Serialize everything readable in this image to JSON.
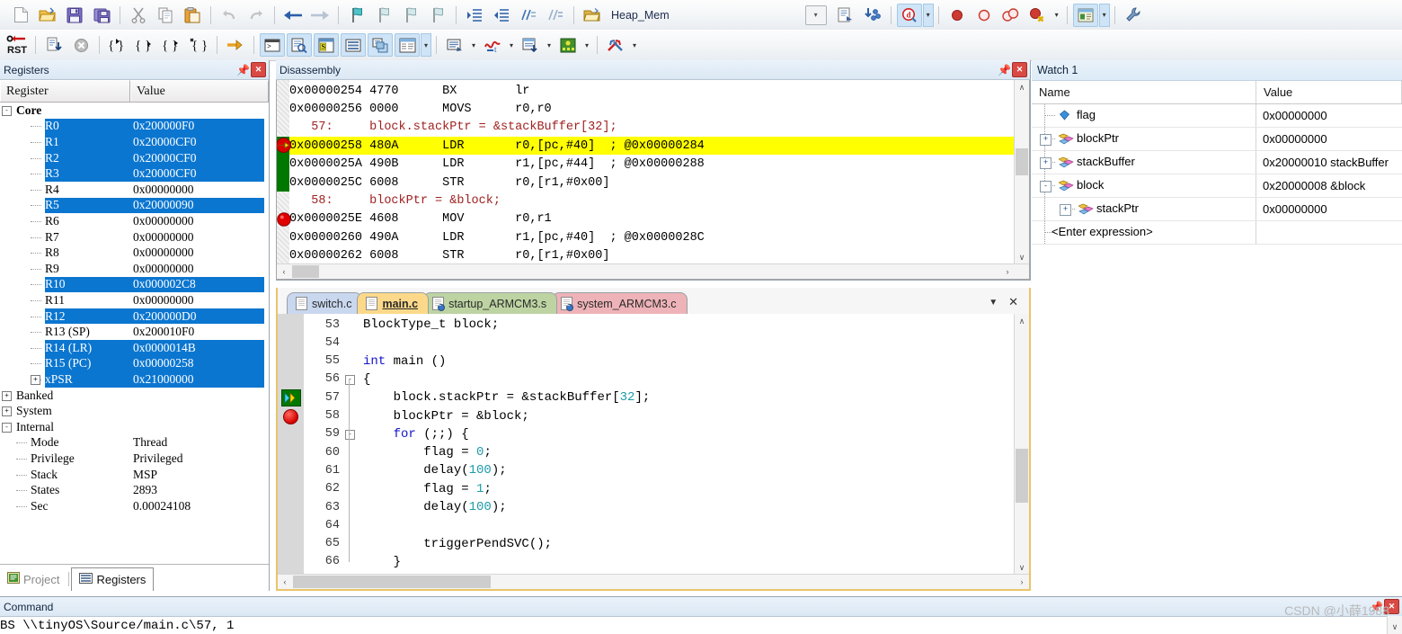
{
  "toolbar1": {
    "icons": [
      {
        "name": "new-file-icon",
        "glyph": "doc"
      },
      {
        "name": "open-file-icon",
        "glyph": "folder"
      },
      {
        "name": "save-icon",
        "glyph": "floppy"
      },
      {
        "name": "save-all-icon",
        "glyph": "floppy-multi"
      },
      {
        "name": "cut-icon",
        "glyph": "scissors"
      },
      {
        "name": "copy-icon",
        "glyph": "copy"
      },
      {
        "name": "paste-icon",
        "glyph": "paste"
      },
      {
        "name": "undo-icon",
        "glyph": "undo"
      },
      {
        "name": "redo-icon",
        "glyph": "redo"
      },
      {
        "name": "navigate-back-icon",
        "glyph": "arrow-left"
      },
      {
        "name": "navigate-forward-icon",
        "glyph": "arrow-right"
      },
      {
        "name": "bookmark-toggle-icon",
        "glyph": "flag"
      },
      {
        "name": "bookmark-prev-icon",
        "glyph": "flag-prev"
      },
      {
        "name": "bookmark-next-icon",
        "glyph": "flag-next"
      },
      {
        "name": "bookmark-clear-icon",
        "glyph": "flag-clear"
      },
      {
        "name": "indent-icon",
        "glyph": "indent"
      },
      {
        "name": "outdent-icon",
        "glyph": "outdent"
      },
      {
        "name": "comment-icon",
        "glyph": "comment"
      },
      {
        "name": "uncomment-icon",
        "glyph": "uncomment"
      }
    ],
    "combo_value": "Heap_Mem",
    "combo_icon": "open-project-icon",
    "after_combo": [
      {
        "name": "target-options-icon",
        "glyph": "target-opts"
      },
      {
        "name": "manage-components-icon",
        "glyph": "components"
      }
    ],
    "debug_tool": {
      "name": "start-stop-debug-icon",
      "glyph": "debug-magnifier"
    },
    "breakpoint_tools": [
      {
        "name": "insert-breakpoint-icon",
        "glyph": "bp-solid"
      },
      {
        "name": "disable-breakpoint-icon",
        "glyph": "bp-hollow"
      },
      {
        "name": "disable-all-breakpoints-icon",
        "glyph": "bp-double"
      },
      {
        "name": "kill-all-breakpoints-icon",
        "glyph": "bp-kill"
      }
    ],
    "window_tool": {
      "name": "window-layout-icon",
      "glyph": "win-layout"
    },
    "config_tool": {
      "name": "configuration-wizard-icon",
      "glyph": "wrench"
    }
  },
  "toolbar2": {
    "reset_label": "RST",
    "icons": [
      {
        "name": "reset-cpu-icon",
        "glyph": "rst"
      },
      {
        "name": "run-icon",
        "glyph": "run"
      },
      {
        "name": "stop-icon",
        "glyph": "stop"
      },
      {
        "name": "step-into-icon",
        "glyph": "step-into"
      },
      {
        "name": "step-over-icon",
        "glyph": "step-over"
      },
      {
        "name": "step-out-icon",
        "glyph": "step-out"
      },
      {
        "name": "run-to-cursor-icon",
        "glyph": "run-to-cursor"
      },
      {
        "name": "show-next-statement-icon",
        "glyph": "next-stmt"
      },
      {
        "name": "command-window-icon",
        "glyph": "console",
        "selected": true
      },
      {
        "name": "disassembly-window-icon",
        "glyph": "disasm",
        "selected": true
      },
      {
        "name": "symbols-window-icon",
        "glyph": "symbols",
        "selected": true
      },
      {
        "name": "registers-window-icon",
        "glyph": "registers",
        "selected": true
      },
      {
        "name": "call-stack-window-icon",
        "glyph": "callstack",
        "selected": true
      },
      {
        "name": "watch-window-icon",
        "glyph": "watch",
        "selected": true
      },
      {
        "name": "memory-window-icon",
        "glyph": "memory",
        "selected": true
      },
      {
        "name": "serial-window-icon",
        "glyph": "serial"
      },
      {
        "name": "analysis-window-icon",
        "glyph": "analysis"
      },
      {
        "name": "trace-window-icon",
        "glyph": "trace"
      },
      {
        "name": "system-viewer-icon",
        "glyph": "sysviewer"
      },
      {
        "name": "toolbox-icon",
        "glyph": "toolbox"
      }
    ]
  },
  "registers": {
    "panel_title": "Registers",
    "columns": [
      "Register",
      "Value"
    ],
    "rows": [
      {
        "name": "Core",
        "value": "",
        "level": 0,
        "expander": "-",
        "bold": true,
        "hl": false
      },
      {
        "name": "R0",
        "value": "0x200000F0",
        "level": 2,
        "expander": "",
        "bold": false,
        "hl": true
      },
      {
        "name": "R1",
        "value": "0x20000CF0",
        "level": 2,
        "expander": "",
        "bold": false,
        "hl": true
      },
      {
        "name": "R2",
        "value": "0x20000CF0",
        "level": 2,
        "expander": "",
        "bold": false,
        "hl": true
      },
      {
        "name": "R3",
        "value": "0x20000CF0",
        "level": 2,
        "expander": "",
        "bold": false,
        "hl": true
      },
      {
        "name": "R4",
        "value": "0x00000000",
        "level": 2,
        "expander": "",
        "bold": false,
        "hl": false
      },
      {
        "name": "R5",
        "value": "0x20000090",
        "level": 2,
        "expander": "",
        "bold": false,
        "hl": true
      },
      {
        "name": "R6",
        "value": "0x00000000",
        "level": 2,
        "expander": "",
        "bold": false,
        "hl": false
      },
      {
        "name": "R7",
        "value": "0x00000000",
        "level": 2,
        "expander": "",
        "bold": false,
        "hl": false
      },
      {
        "name": "R8",
        "value": "0x00000000",
        "level": 2,
        "expander": "",
        "bold": false,
        "hl": false
      },
      {
        "name": "R9",
        "value": "0x00000000",
        "level": 2,
        "expander": "",
        "bold": false,
        "hl": false
      },
      {
        "name": "R10",
        "value": "0x000002C8",
        "level": 2,
        "expander": "",
        "bold": false,
        "hl": true
      },
      {
        "name": "R11",
        "value": "0x00000000",
        "level": 2,
        "expander": "",
        "bold": false,
        "hl": false
      },
      {
        "name": "R12",
        "value": "0x200000D0",
        "level": 2,
        "expander": "",
        "bold": false,
        "hl": true
      },
      {
        "name": "R13 (SP)",
        "value": "0x200010F0",
        "level": 2,
        "expander": "",
        "bold": false,
        "hl": false
      },
      {
        "name": "R14 (LR)",
        "value": "0x0000014B",
        "level": 2,
        "expander": "",
        "bold": false,
        "hl": true
      },
      {
        "name": "R15 (PC)",
        "value": "0x00000258",
        "level": 2,
        "expander": "",
        "bold": false,
        "hl": true
      },
      {
        "name": "xPSR",
        "value": "0x21000000",
        "level": 2,
        "expander": "+",
        "bold": false,
        "hl": true
      },
      {
        "name": "Banked",
        "value": "",
        "level": 0,
        "expander": "+",
        "bold": false,
        "hl": false
      },
      {
        "name": "System",
        "value": "",
        "level": 0,
        "expander": "+",
        "bold": false,
        "hl": false
      },
      {
        "name": "Internal",
        "value": "",
        "level": 0,
        "expander": "-",
        "bold": false,
        "hl": false
      },
      {
        "name": "Mode",
        "value": "Thread",
        "level": 1,
        "expander": "",
        "bold": false,
        "hl": false
      },
      {
        "name": "Privilege",
        "value": "Privileged",
        "level": 1,
        "expander": "",
        "bold": false,
        "hl": false
      },
      {
        "name": "Stack",
        "value": "MSP",
        "level": 1,
        "expander": "",
        "bold": false,
        "hl": false
      },
      {
        "name": "States",
        "value": "2893",
        "level": 1,
        "expander": "",
        "bold": false,
        "hl": false
      },
      {
        "name": "Sec",
        "value": "0.00024108",
        "level": 1,
        "expander": "",
        "bold": false,
        "hl": false
      }
    ],
    "bottom_tabs": [
      {
        "label": "Project",
        "icon": "project-icon",
        "active": false
      },
      {
        "label": "Registers",
        "icon": "registers-icon",
        "active": true
      }
    ]
  },
  "disassembly": {
    "panel_title": "Disassembly",
    "lines": [
      {
        "kind": "asm",
        "text": "0x00000254 4770      BX        lr",
        "marker": "none",
        "current": false
      },
      {
        "kind": "asm",
        "text": "0x00000256 0000      MOVS      r0,r0",
        "marker": "none",
        "current": false
      },
      {
        "kind": "src",
        "text": "   57:     block.stackPtr = &stackBuffer[32];",
        "marker": "none",
        "current": false
      },
      {
        "kind": "asm",
        "text": "0x00000258 480A      LDR       r0,[pc,#40]  ; @0x00000284",
        "marker": "pc",
        "current": true
      },
      {
        "kind": "asm",
        "text": "0x0000025A 490B      LDR       r1,[pc,#44]  ; @0x00000288",
        "marker": "green",
        "current": false
      },
      {
        "kind": "asm",
        "text": "0x0000025C 6008      STR       r0,[r1,#0x00]",
        "marker": "green",
        "current": false
      },
      {
        "kind": "src",
        "text": "   58:     blockPtr = &block;",
        "marker": "none",
        "current": false
      },
      {
        "kind": "asm",
        "text": "0x0000025E 4608      MOV       r0,r1",
        "marker": "bp",
        "current": false
      },
      {
        "kind": "asm",
        "text": "0x00000260 490A      LDR       r1,[pc,#40]  ; @0x0000028C",
        "marker": "none",
        "current": false
      },
      {
        "kind": "asm",
        "text": "0x00000262 6008      STR       r0,[r1,#0x00]",
        "marker": "none",
        "current": false
      }
    ]
  },
  "watch": {
    "panel_title": "Watch 1",
    "columns": [
      "Name",
      "Value"
    ],
    "rows": [
      {
        "name": "flag",
        "value": "0x00000000",
        "expander": "",
        "indent": 0,
        "icon": "variable-icon",
        "placeholder": false
      },
      {
        "name": "blockPtr",
        "value": "0x00000000",
        "expander": "+",
        "indent": 0,
        "icon": "struct-icon",
        "placeholder": false
      },
      {
        "name": "stackBuffer",
        "value": "0x20000010 stackBuffer",
        "expander": "+",
        "indent": 0,
        "icon": "struct-icon",
        "placeholder": false
      },
      {
        "name": "block",
        "value": "0x20000008 &block",
        "expander": "-",
        "indent": 0,
        "icon": "struct-icon",
        "placeholder": false
      },
      {
        "name": "stackPtr",
        "value": "0x00000000",
        "expander": "+",
        "indent": 1,
        "icon": "struct-icon",
        "placeholder": false
      },
      {
        "name": "<Enter expression>",
        "value": "",
        "expander": "",
        "indent": 0,
        "icon": "none",
        "placeholder": true
      }
    ]
  },
  "editor": {
    "tabs": [
      {
        "label": "switch.c",
        "color": "#c9d7ef",
        "active": false,
        "icon": "c-file-icon"
      },
      {
        "label": "main.c",
        "color": "#fcd98a",
        "active": true,
        "icon": "c-file-icon"
      },
      {
        "label": "startup_ARMCM3.s",
        "color": "#bdd4a2",
        "active": false,
        "icon": "asm-file-icon"
      },
      {
        "label": "system_ARMCM3.c",
        "color": "#eeb3b8",
        "active": false,
        "icon": "c-file-icon"
      }
    ],
    "dropdown_icon": "tab-list-icon",
    "close_icon": "close-tab-icon",
    "lines": [
      {
        "num": "53",
        "text": "BlockType_t block;",
        "indent": 0,
        "marker": "none",
        "fold": ""
      },
      {
        "num": "54",
        "text": "",
        "indent": 0,
        "marker": "none",
        "fold": ""
      },
      {
        "num": "55",
        "text": "int main ()",
        "indent": 0,
        "marker": "none",
        "fold": "",
        "kw": "int"
      },
      {
        "num": "56",
        "text": "{",
        "indent": 0,
        "marker": "none",
        "fold": "-"
      },
      {
        "num": "57",
        "text": "    block.stackPtr = &stackBuffer[32];",
        "indent": 0,
        "marker": "pc",
        "fold": "",
        "num_tok": "32"
      },
      {
        "num": "58",
        "text": "    blockPtr = &block;",
        "indent": 0,
        "marker": "bp",
        "fold": ""
      },
      {
        "num": "59",
        "text": "    for (;;) {",
        "indent": 0,
        "marker": "none",
        "fold": "-",
        "kw": "for"
      },
      {
        "num": "60",
        "text": "        flag = 0;",
        "indent": 0,
        "marker": "none",
        "fold": "",
        "num_tok": "0"
      },
      {
        "num": "61",
        "text": "        delay(100);",
        "indent": 0,
        "marker": "none",
        "fold": "",
        "num_tok": "100"
      },
      {
        "num": "62",
        "text": "        flag = 1;",
        "indent": 0,
        "marker": "none",
        "fold": "",
        "num_tok": "1"
      },
      {
        "num": "63",
        "text": "        delay(100);",
        "indent": 0,
        "marker": "none",
        "fold": "",
        "num_tok": "100"
      },
      {
        "num": "64",
        "text": "",
        "indent": 0,
        "marker": "none",
        "fold": ""
      },
      {
        "num": "65",
        "text": "        triggerPendSVC();",
        "indent": 0,
        "marker": "none",
        "fold": ""
      },
      {
        "num": "66",
        "text": "    }",
        "indent": 0,
        "marker": "none",
        "fold": ""
      }
    ]
  },
  "command": {
    "panel_title": "Command",
    "text": "BS \\\\tinyOS\\Source/main.c\\57, 1"
  },
  "watermark": "CSDN @小薛1988",
  "colors": {
    "highlight_row": "#0b76d0",
    "current_line": "#ffff00",
    "pc_marker_green": "#007800",
    "breakpoint_red": "#d60000",
    "toolbar_selected": "#cfe4f7",
    "editor_border": "#e8c56a"
  }
}
